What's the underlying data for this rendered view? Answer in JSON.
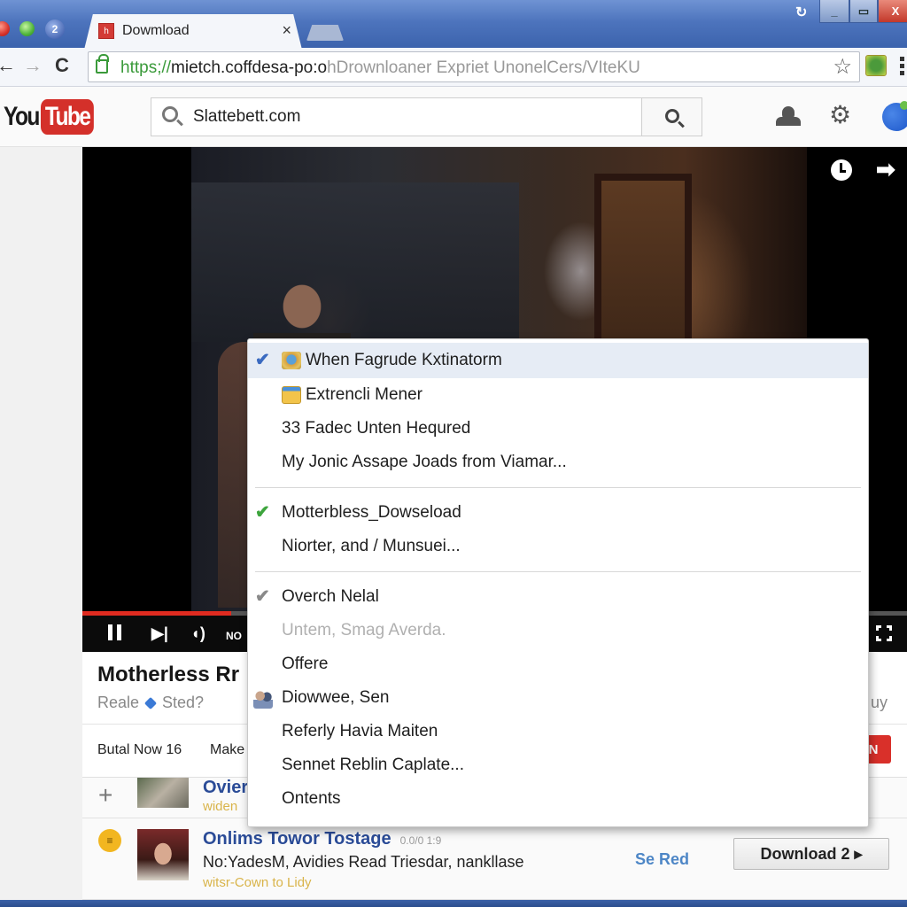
{
  "browser": {
    "tab": {
      "favicon": "h",
      "title": "Dowmload",
      "close_icon": "×"
    },
    "app_badge": "2",
    "system_refresh_icon": "↻",
    "window_buttons": {
      "minimize": "_",
      "maximize": "▭",
      "close": "X"
    },
    "nav": {
      "back": "←",
      "forward": "→",
      "reload": "C"
    },
    "url": {
      "scheme": "https;//",
      "host": "mietch.coffdesa-po:o",
      "path": "hDrownloaner Expriet UnonelCers/VIteKU"
    },
    "bookmark_icon": "☆"
  },
  "youtube": {
    "logo": {
      "you": "You",
      "tube": "Tube"
    },
    "search": {
      "value": "Slattebett.com",
      "placeholder": ""
    },
    "header_icons": [
      "user-icon",
      "gear-icon",
      "account-avatar"
    ],
    "gear_glyph": "⚙"
  },
  "player": {
    "progress_fraction": 0.18,
    "colors": {
      "progress": "#e02b20"
    },
    "controls": {
      "next": "▶|",
      "volume": "◖)",
      "quality": "NO"
    },
    "share_glyph": "➡"
  },
  "video": {
    "title": "Motherless Rr",
    "channel": "Reale",
    "channel_suffix": "Sted?",
    "right_text": "uy",
    "actions": [
      "Butal Now 16",
      "Make"
    ],
    "subscribe_label": "N"
  },
  "related": [
    {
      "lead": "+",
      "title": "Ovier",
      "sub": "widen"
    },
    {
      "lead": "≡",
      "title": "Onlims Towor Tostage",
      "meta": "0.0/0 1:9",
      "desc": "No:YadesM, Avidies Read Triesdar, nankllase",
      "sub": "witsr-Cown to Lidy",
      "link": "Se Red",
      "download_label": "Download 2 ▸"
    }
  ],
  "context_menu": {
    "groups": [
      [
        {
          "label": "When Fagrude Kxtinatorm",
          "check": "blue",
          "emblem": "globe",
          "highlight": true
        },
        {
          "label": "Extrencli Mener",
          "emblem": "folder"
        },
        {
          "label": "33 Fadec Unten Hequred"
        },
        {
          "label": "My Jonic Assape Joads from Viamar..."
        }
      ],
      [
        {
          "label": "Motterbless_Dowseload",
          "check": "green"
        },
        {
          "label": "Niorter, and / Munsuei..."
        }
      ],
      [
        {
          "label": "Overch Nelal",
          "check": "gray"
        },
        {
          "label": "Untem, Smag Averda.",
          "disabled": true
        },
        {
          "label": "Offere"
        },
        {
          "label": "Diowwee, Sen",
          "emblem": "people"
        },
        {
          "label": "Referly Havia Maiten"
        },
        {
          "label": "Sennet Reblin Caplate..."
        },
        {
          "label": "Ontents"
        }
      ]
    ],
    "check_glyph": "✔"
  }
}
